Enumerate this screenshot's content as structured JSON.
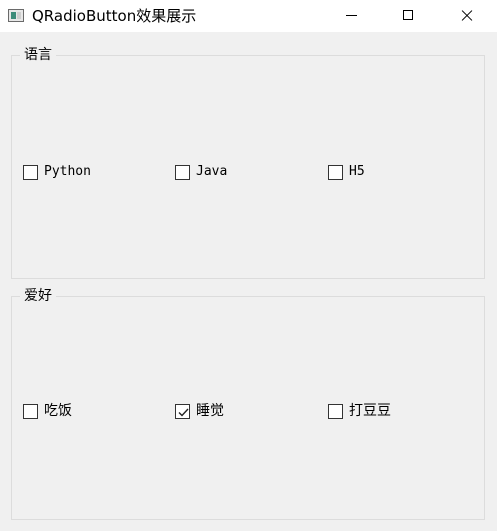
{
  "window": {
    "title": "QRadioButton效果展示",
    "icon": "qt-window-icon",
    "controls": [
      "minimize-icon",
      "maximize-icon",
      "close-icon"
    ]
  },
  "groups": [
    {
      "title": "语言",
      "options": [
        {
          "label": "Python",
          "checked": false
        },
        {
          "label": "Java",
          "checked": false
        },
        {
          "label": "H5",
          "checked": false
        }
      ]
    },
    {
      "title": "爱好",
      "options": [
        {
          "label": "吃饭",
          "checked": false
        },
        {
          "label": "睡觉",
          "checked": true
        },
        {
          "label": "打豆豆",
          "checked": false
        }
      ]
    }
  ],
  "colors": {
    "background": "#f0f0f0",
    "titlebar": "#ffffff",
    "groupbox_border": "#dcdcdc",
    "checkbox_border": "#333333"
  }
}
